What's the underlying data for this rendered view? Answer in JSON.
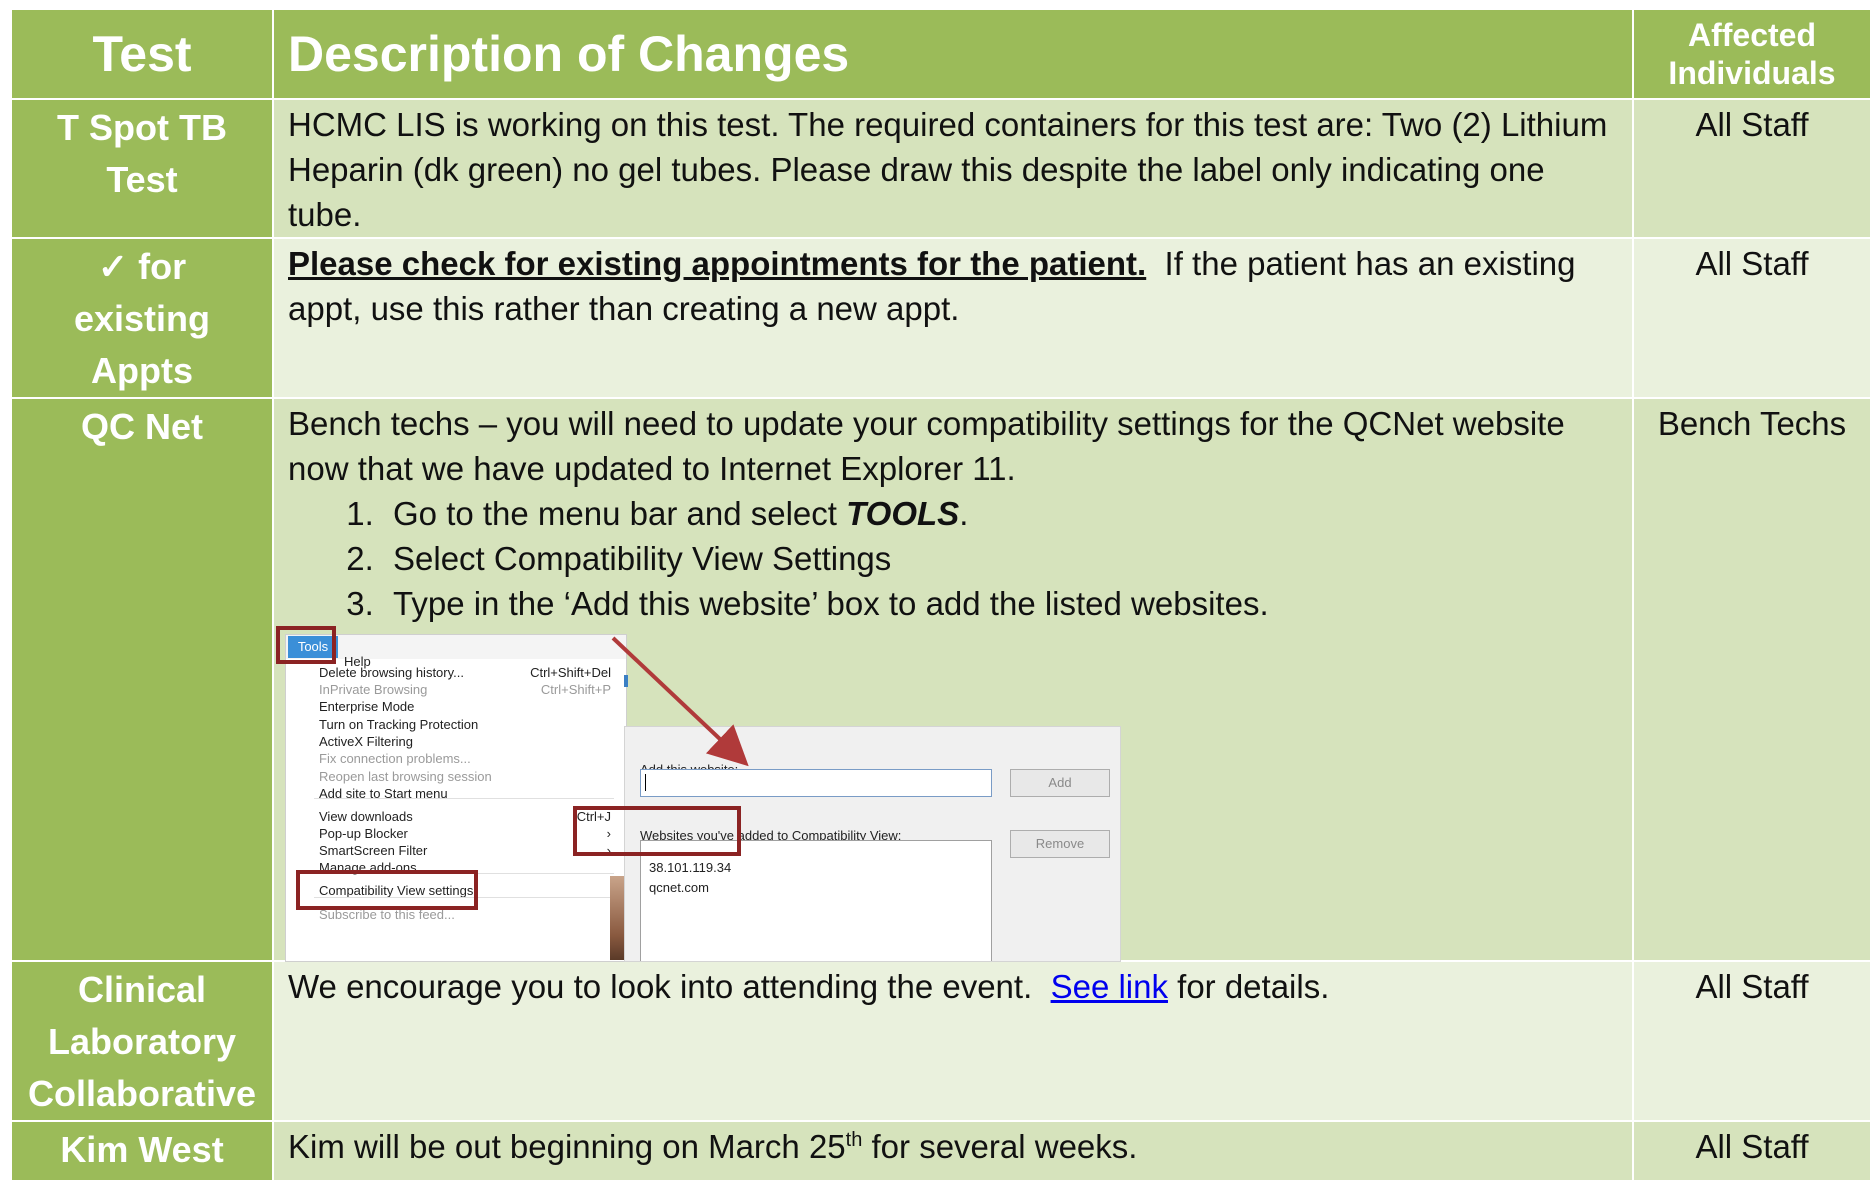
{
  "header": {
    "test": "Test",
    "description": "Description of Changes",
    "affected": "Affected Individuals"
  },
  "rows": [
    {
      "test": "T Spot TB Test",
      "description": "HCMC LIS is working on this test.  The required containers for this test are: Two (2) Lithium Heparin (dk green) no gel tubes.  Please draw this despite the label only indicating one tube.",
      "affected": "All Staff"
    },
    {
      "test_check": "✓",
      "test": "for existing Appts",
      "description_bold": "Please check for existing appointments for the patient.",
      "description_rest": "If the patient has an existing appt, use this rather than creating a new appt.",
      "affected": "All Staff"
    },
    {
      "test": "QC Net",
      "description": "Bench techs – you will need to update your compatibility settings for the QCNet website now that we have updated to Internet Explorer 11.",
      "steps": [
        {
          "text": "Go to the menu bar and select ",
          "emph": "TOOLS",
          "after": "."
        },
        {
          "text": "Select Compatibility View Settings",
          "emph": "",
          "after": ""
        },
        {
          "text": "Type in the ‘Add this website’ box to add the listed websites.",
          "emph": "",
          "after": ""
        }
      ],
      "affected": "Bench Techs",
      "screenshot": {
        "menu_tools": "Tools",
        "menu_help": "Help",
        "menu_items": [
          {
            "label": "Delete browsing history...",
            "shortcut": "Ctrl+Shift+Del",
            "dim": false
          },
          {
            "label": "InPrivate Browsing",
            "shortcut": "Ctrl+Shift+P",
            "dim": true
          },
          {
            "label": "Enterprise Mode",
            "shortcut": "",
            "dim": false
          },
          {
            "label": "Turn on Tracking Protection",
            "shortcut": "",
            "dim": false
          },
          {
            "label": "ActiveX Filtering",
            "shortcut": "",
            "dim": false
          },
          {
            "label": "Fix connection problems...",
            "shortcut": "",
            "dim": true
          },
          {
            "label": "Reopen last browsing session",
            "shortcut": "",
            "dim": true
          },
          {
            "label": "Add site to Start menu",
            "shortcut": "",
            "dim": false
          },
          {
            "label": "View downloads",
            "shortcut": "Ctrl+J",
            "dim": false
          },
          {
            "label": "Pop-up Blocker",
            "shortcut": "›",
            "dim": false
          },
          {
            "label": "SmartScreen Filter",
            "shortcut": "›",
            "dim": false
          },
          {
            "label": "Manage add-ons",
            "shortcut": "",
            "dim": false
          },
          {
            "label": "Compatibility View settings",
            "shortcut": "",
            "dim": false
          },
          {
            "label": "Subscribe to this feed...",
            "shortcut": "",
            "dim": true
          }
        ],
        "add_label": "Add this website:",
        "add_button": "Add",
        "list_label": "Websites you've added to Compatibility View:",
        "sites": [
          "38.101.119.34",
          "qcnet.com"
        ],
        "remove_button": "Remove",
        "highlight_color": "#8b2323"
      }
    },
    {
      "test": "Clinical Laboratory Collaborative",
      "description_before": "We encourage you to look into attending the event.  ",
      "link": "See link",
      "description_after": " for details.",
      "affected": "All Staff"
    },
    {
      "test": "Kim West",
      "description_before": "Kim will be out beginning on March 25",
      "description_sup": "th",
      "description_after": " for several weeks.",
      "affected": "All Staff"
    }
  ],
  "colors": {
    "header_green": "#9bbb59",
    "row_light": "#d6e3bc",
    "row_lighter": "#eaf1dd",
    "link_blue": "#0000ee"
  }
}
